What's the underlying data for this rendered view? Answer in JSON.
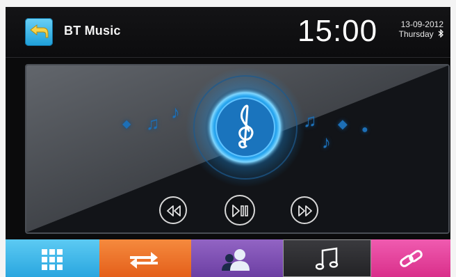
{
  "header": {
    "title": "BT Music",
    "time": "15:00",
    "date": "13-09-2012",
    "weekday": "Thursday",
    "back_icon": "back-arrow-icon",
    "bluetooth_icon": "bluetooth-icon"
  },
  "player": {
    "center_icon": "treble-clef-icon",
    "controls": [
      {
        "name": "previous",
        "icon": "rewind-icon"
      },
      {
        "name": "play-pause",
        "icon": "play-pause-icon"
      },
      {
        "name": "next",
        "icon": "fast-forward-icon"
      }
    ]
  },
  "tabs": [
    {
      "name": "apps",
      "icon": "grid-icon",
      "color": "#3db6e8"
    },
    {
      "name": "transfer",
      "icon": "swap-arrows-icon",
      "color": "#ef6a23"
    },
    {
      "name": "contacts",
      "icon": "contacts-icon",
      "color": "#7c4fb0"
    },
    {
      "name": "music",
      "icon": "music-note-icon",
      "color": "#2b2b2e",
      "active": true
    },
    {
      "name": "link",
      "icon": "link-icon",
      "color": "#e43e9a"
    }
  ],
  "colors": {
    "accent": "#1e9fd9",
    "glow": "#2aa7f0"
  }
}
